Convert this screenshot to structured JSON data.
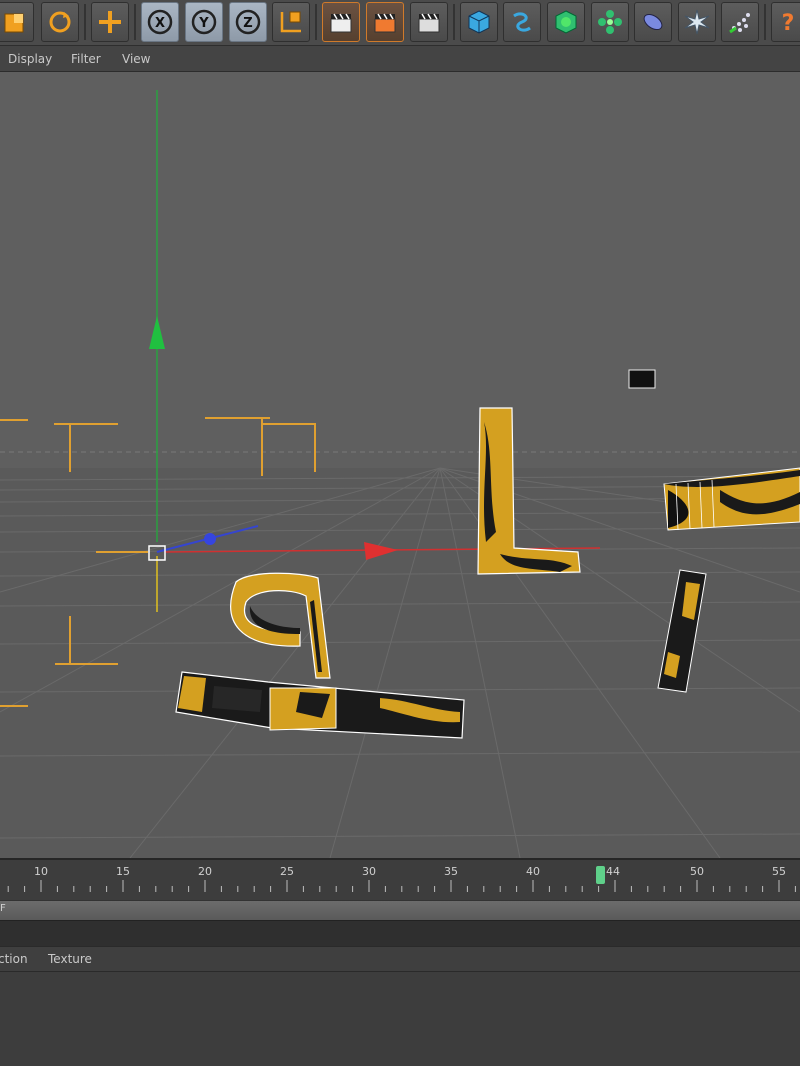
{
  "menu": {
    "display": "Display",
    "filter": "Filter",
    "view": "View"
  },
  "toolbar": {
    "axis_x": "X",
    "axis_y": "Y",
    "axis_z": "Z",
    "help": "?"
  },
  "timeline": {
    "ticks": [
      "10",
      "15",
      "20",
      "25",
      "30",
      "35",
      "40",
      "50",
      "55"
    ],
    "current_frame": "44",
    "frame_bar_label": "F"
  },
  "attributes": {
    "tab_selection": "ction",
    "tab_texture": "Texture"
  },
  "colors": {
    "accent_orange": "#f0a020",
    "axis_green": "#20c040",
    "axis_red": "#e03030",
    "axis_blue": "#3040e0",
    "playhead": "#5fd08a"
  }
}
